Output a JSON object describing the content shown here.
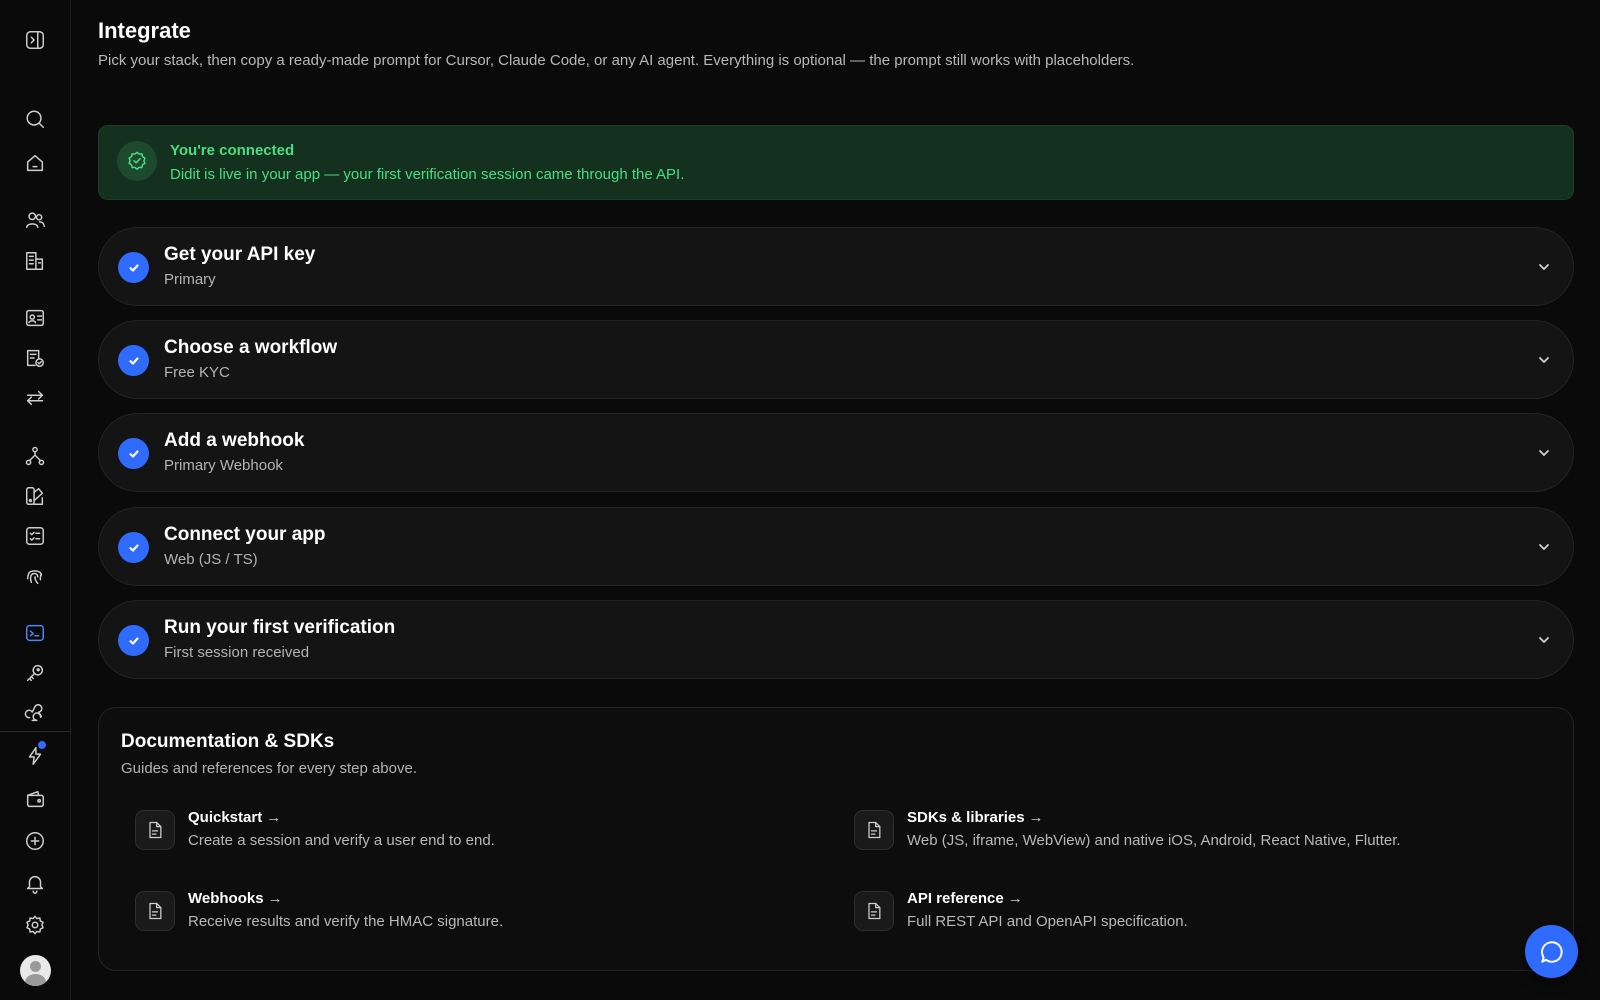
{
  "sidebar": {
    "items": [
      {
        "icon": "panel-toggle-icon"
      },
      {
        "icon": "search-icon"
      },
      {
        "icon": "home-icon"
      },
      {
        "icon": "users-icon"
      },
      {
        "icon": "buildings-icon"
      },
      {
        "icon": "id-card-icon"
      },
      {
        "icon": "document-check-icon"
      },
      {
        "icon": "transfer-arrows-icon"
      },
      {
        "icon": "workflow-icon"
      },
      {
        "icon": "palette-icon"
      },
      {
        "icon": "checklist-icon"
      },
      {
        "icon": "fingerprint-icon"
      },
      {
        "icon": "terminal-icon",
        "active": true
      },
      {
        "icon": "key-icon"
      },
      {
        "icon": "webhook-icon"
      },
      {
        "icon": "lightning-icon",
        "notification": true
      },
      {
        "icon": "wallet-icon"
      },
      {
        "icon": "plus-circle-icon"
      },
      {
        "icon": "bell-icon"
      },
      {
        "icon": "gear-icon"
      },
      {
        "icon": "avatar"
      }
    ]
  },
  "header": {
    "title": "Integrate",
    "subtitle": "Pick your stack, then copy a ready-made prompt for Cursor, Claude Code, or any AI agent. Everything is optional — the prompt still works with placeholders."
  },
  "banner": {
    "title": "You're connected",
    "text": "Didit is live in your app — your first verification session came through the API.",
    "color": "#4ade80"
  },
  "steps": [
    {
      "title": "Get your API key",
      "subtitle": "Primary",
      "completed": true
    },
    {
      "title": "Choose a workflow",
      "subtitle": "Free KYC",
      "completed": true
    },
    {
      "title": "Add a webhook",
      "subtitle": "Primary Webhook",
      "completed": true
    },
    {
      "title": "Connect your app",
      "subtitle": "Web (JS / TS)",
      "completed": true
    },
    {
      "title": "Run your first verification",
      "subtitle": "First session received",
      "completed": true
    }
  ],
  "docs": {
    "title": "Documentation & SDKs",
    "subtitle": "Guides and references for every step above.",
    "arrow": "→",
    "links": [
      {
        "title": "Quickstart",
        "description": "Create a session and verify a user end to end."
      },
      {
        "title": "SDKs & libraries",
        "description": "Web (JS, iframe, WebView) and native iOS, Android, React Native, Flutter."
      },
      {
        "title": "Webhooks",
        "description": "Receive results and verify the HMAC signature."
      },
      {
        "title": "API reference",
        "description": "Full REST API and OpenAPI specification."
      }
    ]
  },
  "colors": {
    "accent": "#2f6bff",
    "background": "#0a0a0a",
    "success": "#4ade80"
  }
}
